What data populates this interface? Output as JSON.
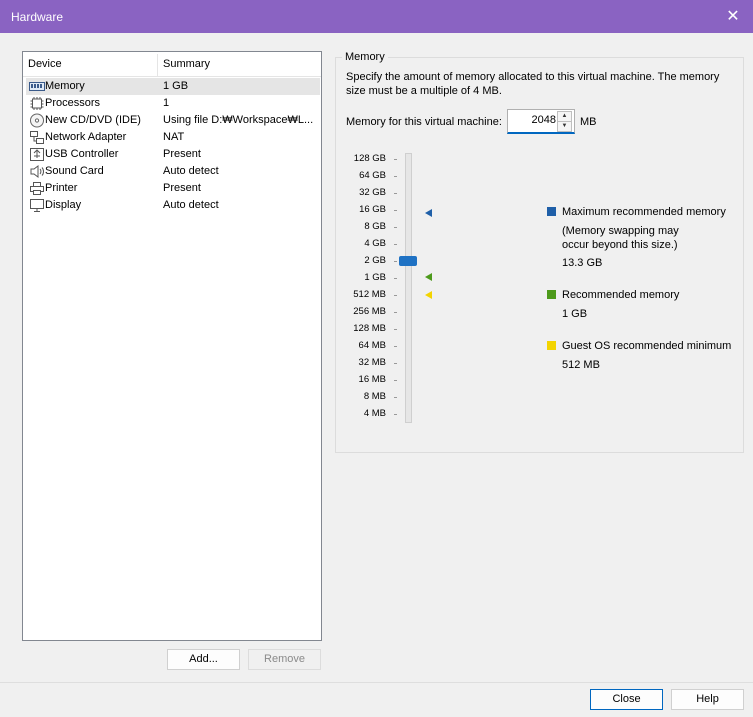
{
  "window": {
    "title": "Hardware"
  },
  "device_list": {
    "headers": {
      "device": "Device",
      "summary": "Summary"
    },
    "rows": [
      {
        "device": "Memory",
        "summary": "1 GB",
        "icon": "memory-icon"
      },
      {
        "device": "Processors",
        "summary": "1",
        "icon": "processor-icon"
      },
      {
        "device": "New CD/DVD (IDE)",
        "summary": "Using file D:₩Workspace₩L...",
        "icon": "cd-icon"
      },
      {
        "device": "Network Adapter",
        "summary": "NAT",
        "icon": "network-icon"
      },
      {
        "device": "USB Controller",
        "summary": "Present",
        "icon": "usb-icon"
      },
      {
        "device": "Sound Card",
        "summary": "Auto detect",
        "icon": "speaker-icon"
      },
      {
        "device": "Printer",
        "summary": "Present",
        "icon": "printer-icon"
      },
      {
        "device": "Display",
        "summary": "Auto detect",
        "icon": "display-icon"
      }
    ],
    "add_label": "Add...",
    "remove_label": "Remove"
  },
  "memory": {
    "group_title": "Memory",
    "description": "Specify the amount of memory allocated to this virtual machine. The memory size must be a multiple of 4 MB.",
    "field_label": "Memory for this virtual machine:",
    "value": "2048",
    "unit": "MB",
    "scale_ticks": [
      "128 GB",
      "64 GB",
      "32 GB",
      "16 GB",
      "8 GB",
      "4 GB",
      "2 GB",
      "1 GB",
      "512 MB",
      "256 MB",
      "128 MB",
      "64 MB",
      "32 MB",
      "16 MB",
      "8 MB",
      "4 MB"
    ],
    "slider_value": "2 GB",
    "legend": {
      "max_title": "Maximum recommended memory",
      "max_note": "(Memory swapping may occur beyond this size.)",
      "max_value": "13.3 GB",
      "rec_title": "Recommended memory",
      "rec_value": "1 GB",
      "min_title": "Guest OS recommended minimum",
      "min_value": "512 MB"
    },
    "colors": {
      "max": "#1f5fa8",
      "rec": "#4d9a1b",
      "min": "#f3d400",
      "thumb": "#1f72c4"
    }
  },
  "footer": {
    "close_label": "Close",
    "help_label": "Help"
  }
}
